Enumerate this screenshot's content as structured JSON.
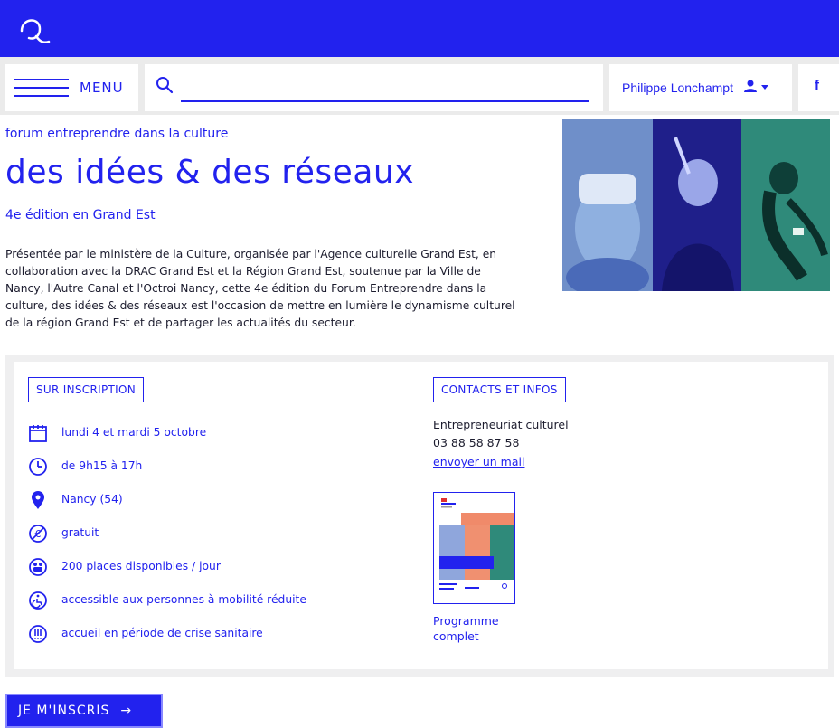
{
  "header": {
    "logo_icon": "q-logo-icon",
    "brand_color": "#2222ee"
  },
  "nav": {
    "menu_label": "MENU",
    "search_placeholder": "",
    "search_value": "",
    "user_name": "Philippe Lonchampt",
    "facebook_label": "f"
  },
  "hero": {
    "kicker": "forum entreprendre dans la culture",
    "title": "des idées & des réseaux",
    "edition": "4e édition en Grand Est",
    "intro_lines": [
      "Présentée par le ministère de la Culture, organisée par l'Agence culturelle Grand Est, en",
      "collaboration avec la DRAC Grand Est et la Région Grand Est, soutenue par la Ville de",
      "Nancy, l'Autre Canal et l'Octroi Nancy, cette 4e édition du Forum Entreprendre dans la",
      "culture, des idées & des réseaux est l'occasion de mettre en lumière le dynamisme culturel",
      "de la région Grand Est et de partager les actualités du secteur."
    ]
  },
  "info": {
    "registration_tag": "SUR INSCRIPTION",
    "items": [
      {
        "icon": "calendar-icon",
        "text": "lundi 4 et mardi 5 octobre",
        "link": false
      },
      {
        "icon": "clock-icon",
        "text": "de 9h15 à 17h",
        "link": false
      },
      {
        "icon": "location-pin-icon",
        "text": "Nancy (54)",
        "link": false
      },
      {
        "icon": "free-euro-icon",
        "text": "gratuit",
        "link": false
      },
      {
        "icon": "people-icon",
        "text": "200 places disponibles / jour",
        "link": false
      },
      {
        "icon": "wheelchair-icon",
        "text": "accessible aux personnes à mobilité réduite",
        "link": false
      },
      {
        "icon": "alert-icon",
        "text": "accueil en période de crise sanitaire",
        "link": true
      }
    ]
  },
  "contacts": {
    "tag": "CONTACTS ET INFOS",
    "service": "Entrepreneuriat culturel",
    "phone": "03 88 58 87 58",
    "mail_link": "envoyer un mail",
    "program_label_1": "Programme",
    "program_label_2": "complet"
  },
  "cta": {
    "label": "JE M'INSCRIS",
    "arrow": "→"
  }
}
